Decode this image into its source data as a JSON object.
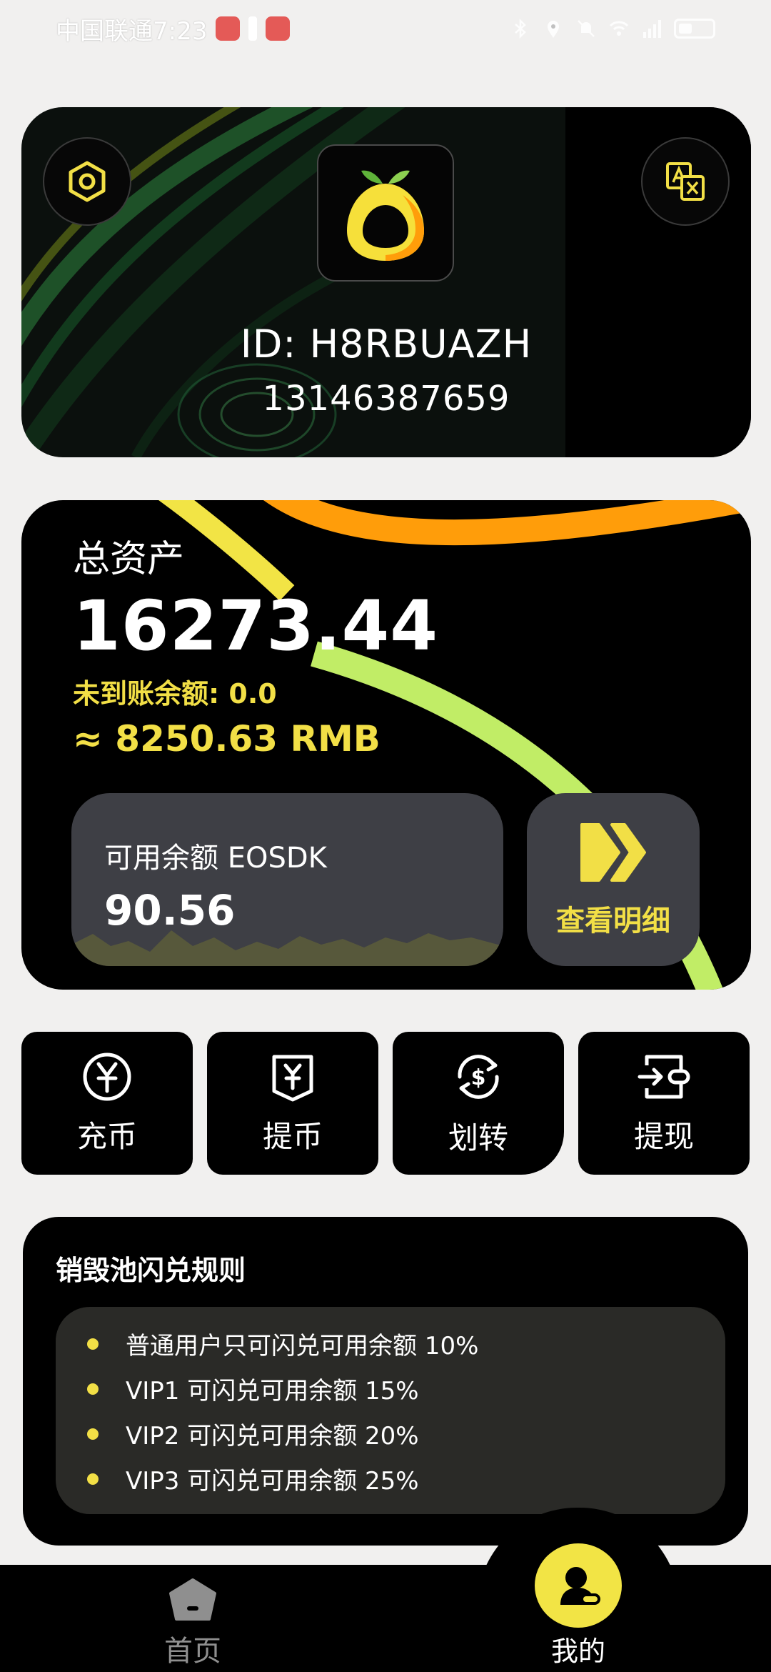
{
  "status_bar": {
    "carrier_time": "中国联通7:23"
  },
  "profile": {
    "id_text": "ID: H8RBUAZH",
    "phone": "13146387659",
    "settings_icon": "hexagon-nut-icon",
    "translate_icon": "translate-icon",
    "logo_icon": "orange-fruit-logo"
  },
  "assets": {
    "title": "总资产",
    "total": "16273.44",
    "pending": "未到账余额: 0.0",
    "rmb": "≈ 8250.63 RMB",
    "available_label": "可用余额 EOSDK",
    "available_value": "90.56",
    "details_label": "查看明细"
  },
  "actions": [
    {
      "label": "充币",
      "icon": "yen-coin-icon"
    },
    {
      "label": "提币",
      "icon": "yen-card-icon"
    },
    {
      "label": "划转",
      "icon": "dollar-exchange-icon"
    },
    {
      "label": "提现",
      "icon": "withdraw-wallet-icon"
    }
  ],
  "rules": {
    "title": "销毁池闪兑规则",
    "items": [
      "普通用户只可闪兑可用余额 10%",
      "VIP1 可闪兑可用余额 15%",
      "VIP2 可闪兑可用余额 20%",
      "VIP3 可闪兑可用余额 25%"
    ]
  },
  "nav": {
    "home_label": "首页",
    "me_label": "我的"
  },
  "colors": {
    "accent_yellow": "#f2df46",
    "orange": "#ff9d0a",
    "lime": "#c1ed66",
    "card_black": "#000000",
    "panel_gray": "#3e3f45",
    "page_bg": "#f1f0ef"
  }
}
